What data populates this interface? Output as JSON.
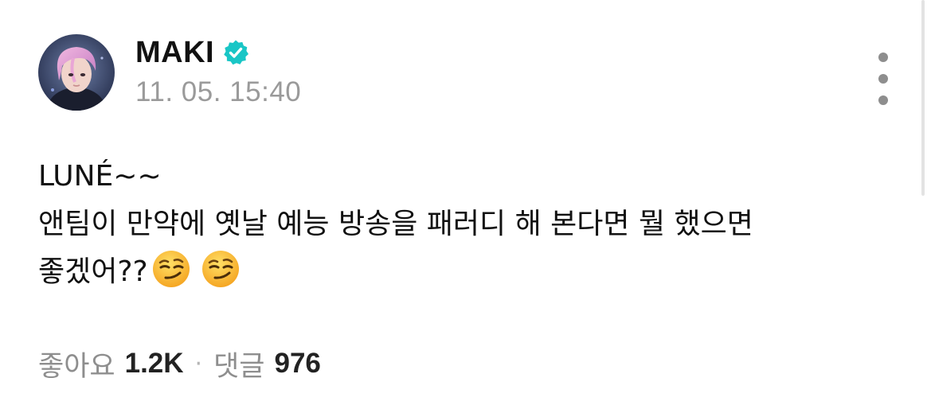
{
  "post": {
    "author": {
      "name": "MAKI",
      "verified": true,
      "avatar_icon": "profile-photo"
    },
    "timestamp": "11. 05. 15:40",
    "body_lines": [
      "LUNÉ~~",
      "앤팀이 만약에 옛날 예능 방송을 패러디 해 본다면 뭘 했으면",
      "좋겠어??"
    ],
    "emojis": [
      "smirking-face",
      "smirking-face"
    ],
    "stats": {
      "likes_label": "좋아요",
      "likes_count": "1.2K",
      "separator": "·",
      "comments_label": "댓글",
      "comments_count": "976"
    },
    "more_icon": "more-vertical-icon",
    "colors": {
      "verified_badge": "#19c6c6",
      "timestamp": "#9a9a9a",
      "label": "#8e8e8e"
    }
  }
}
